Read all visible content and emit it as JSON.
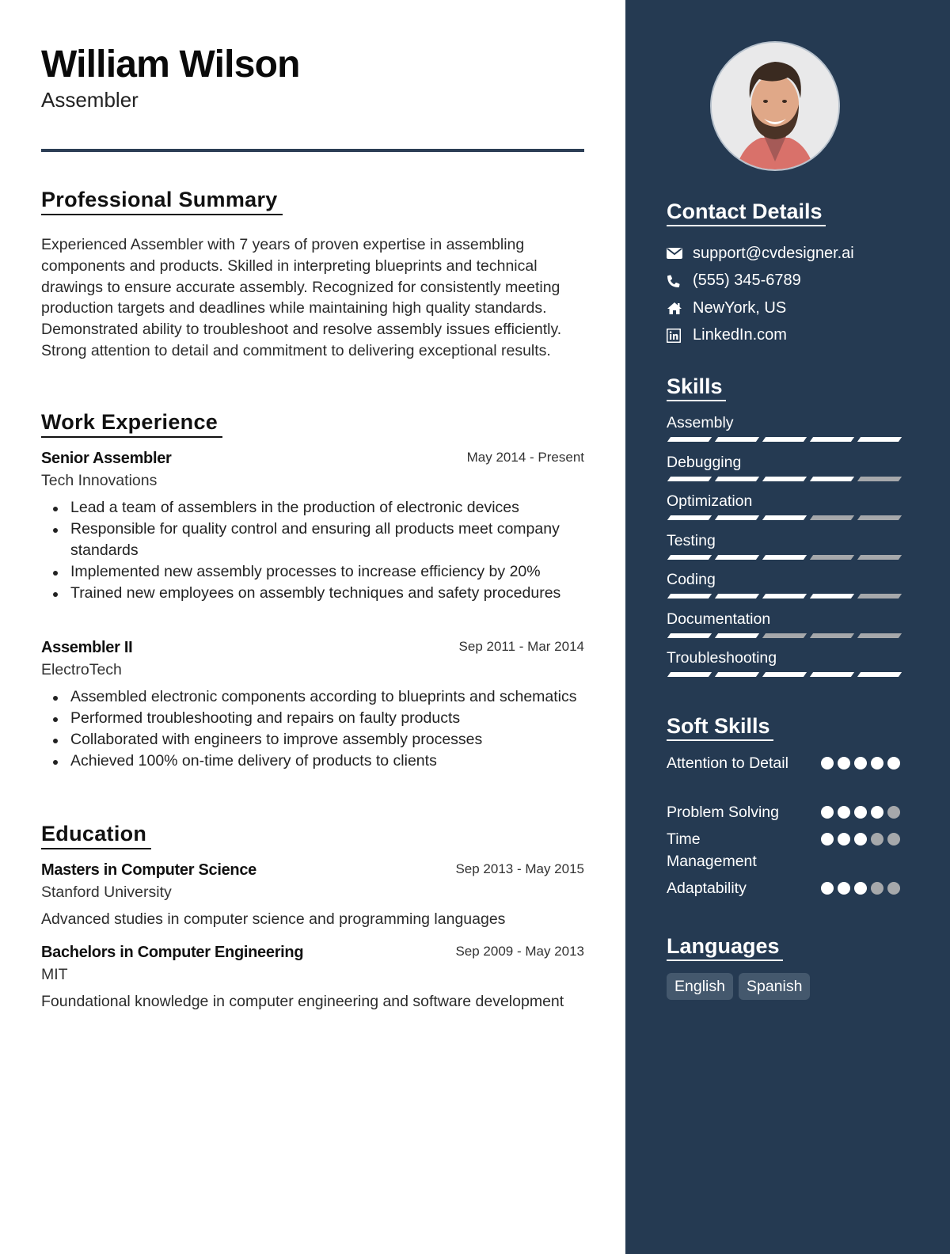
{
  "header": {
    "name": "William Wilson",
    "title": "Assembler"
  },
  "colors": {
    "sidebar": "#253a52",
    "divider": "#2c3e55",
    "rating_on": "#ffffff",
    "rating_off": "#a6a8ab",
    "language_chip": "#44586d"
  },
  "summary": {
    "heading": "Professional Summary",
    "text": "Experienced Assembler with 7 years of proven expertise in assembling components and products. Skilled in interpreting blueprints and technical drawings to ensure accurate assembly. Recognized for consistently meeting production targets and deadlines while maintaining high quality standards. Demonstrated ability to troubleshoot and resolve assembly issues efficiently. Strong attention to detail and commitment to delivering exceptional results."
  },
  "experience": {
    "heading": "Work Experience",
    "jobs": [
      {
        "role": "Senior Assembler",
        "company": "Tech Innovations",
        "dates": "May 2014 - Present",
        "bullets": [
          "Lead a team of assemblers in the production of electronic devices",
          "Responsible for quality control and ensuring all products meet company standards",
          "Implemented new assembly processes to increase efficiency by 20%",
          "Trained new employees on assembly techniques and safety procedures"
        ]
      },
      {
        "role": "Assembler II",
        "company": "ElectroTech",
        "dates": "Sep 2011 - Mar 2014",
        "bullets": [
          "Assembled electronic components according to blueprints and schematics",
          "Performed troubleshooting and repairs on faulty products",
          "Collaborated with engineers to improve assembly processes",
          "Achieved 100% on-time delivery of products to clients"
        ]
      }
    ]
  },
  "education": {
    "heading": "Education",
    "items": [
      {
        "degree": "Masters in Computer Science",
        "school": "Stanford University",
        "dates": "Sep 2013 - May 2015",
        "description": "Advanced studies in computer science and programming languages"
      },
      {
        "degree": "Bachelors in Computer Engineering",
        "school": "MIT",
        "dates": "Sep 2009 - May 2013",
        "description": "Foundational knowledge in computer engineering and software development"
      }
    ]
  },
  "sidebar": {
    "photo_alt": "profile-photo",
    "contact": {
      "heading": "Contact Details",
      "items": [
        {
          "icon": "envelope-icon",
          "text": "support@cvdesigner.ai"
        },
        {
          "icon": "phone-icon",
          "text": "(555) 345-6789"
        },
        {
          "icon": "home-icon",
          "text": "NewYork, US"
        },
        {
          "icon": "linkedin-icon",
          "text": "LinkedIn.com"
        }
      ]
    },
    "skills": {
      "heading": "Skills",
      "max": 5,
      "items": [
        {
          "name": "Assembly",
          "level": 5
        },
        {
          "name": "Debugging",
          "level": 4
        },
        {
          "name": "Optimization",
          "level": 3
        },
        {
          "name": "Testing",
          "level": 3
        },
        {
          "name": "Coding",
          "level": 4
        },
        {
          "name": "Documentation",
          "level": 2
        },
        {
          "name": "Troubleshooting",
          "level": 5
        }
      ]
    },
    "soft_skills": {
      "heading": "Soft Skills",
      "max": 5,
      "items": [
        {
          "name": "Attention to Detail",
          "level": 5
        },
        {
          "name": "Problem Solving",
          "level": 4
        },
        {
          "name": "Time Management",
          "level": 3
        },
        {
          "name": "Adaptability",
          "level": 3
        }
      ]
    },
    "languages": {
      "heading": "Languages",
      "items": [
        "English",
        "Spanish"
      ]
    }
  }
}
